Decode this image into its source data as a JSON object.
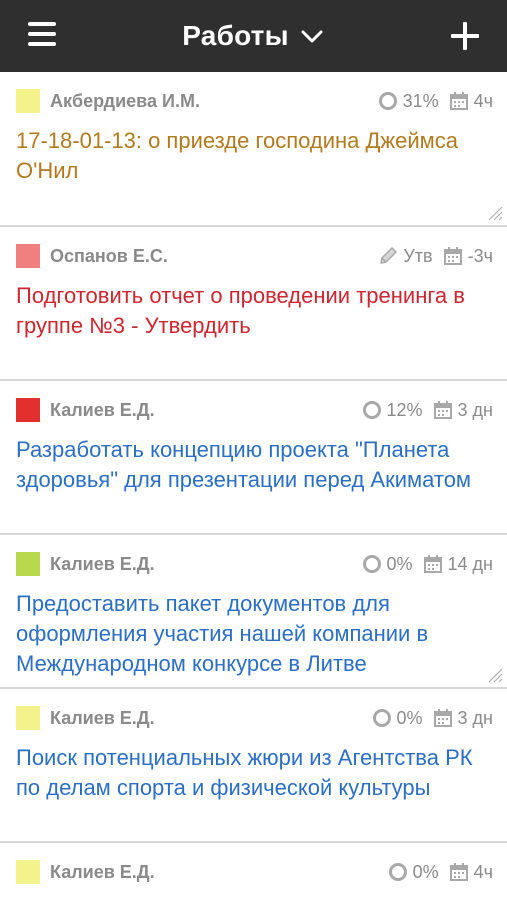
{
  "header": {
    "title": "Работы",
    "menu_icon": "hamburger-icon",
    "dropdown_icon": "chevron-down-icon",
    "add_icon": "plus-icon"
  },
  "tasks": [
    {
      "author": "Акбердиева И.М.",
      "swatch_color": "#f4f28a",
      "status_icon": "progress-circle-icon",
      "status": "31%",
      "time": "4ч",
      "title": "17-18-01-13: о приезде господина Джеймса О'Нил",
      "title_color": "#b07a1e"
    },
    {
      "author": "Оспанов Е.С.",
      "swatch_color": "#f08080",
      "status_icon": "pen-icon",
      "status": "Утв",
      "time": "-3ч",
      "title": "Подготовить отчет о проведении тренинга в группе №3 - Утвердить",
      "title_color": "#cc2630"
    },
    {
      "author": "Калиев Е.Д.",
      "swatch_color": "#e2302f",
      "status_icon": "progress-circle-icon",
      "status": "12%",
      "time": "3 дн",
      "title": "Разработать концепцию проекта \"Планета здоровья\" для презентации перед Акиматом",
      "title_color": "#2c6fc2"
    },
    {
      "author": "Калиев Е.Д.",
      "swatch_color": "#b9d94c",
      "status_icon": "progress-circle-icon",
      "status": "0%",
      "time": "14 дн",
      "title": "Предоставить пакет документов для оформления участия нашей компании в Международном конкурсе в Литве",
      "title_color": "#2c6fc2"
    },
    {
      "author": "Калиев Е.Д.",
      "swatch_color": "#f4f28a",
      "status_icon": "progress-circle-icon",
      "status": "0%",
      "time": "3 дн",
      "title": "Поиск потенциальных жюри из Агентства РК по делам спорта и физической культуры",
      "title_color": "#2c6fc2"
    }
  ],
  "last_task": {
    "author": "Калиев Е.Д.",
    "swatch_color": "#f4f28a",
    "status_icon": "progress-circle-icon",
    "status": "0%",
    "time": "4ч"
  },
  "colors": {
    "topbar": "#2f2f2f",
    "meta_text": "#8a8a8a",
    "divider": "#d6d6d6"
  }
}
